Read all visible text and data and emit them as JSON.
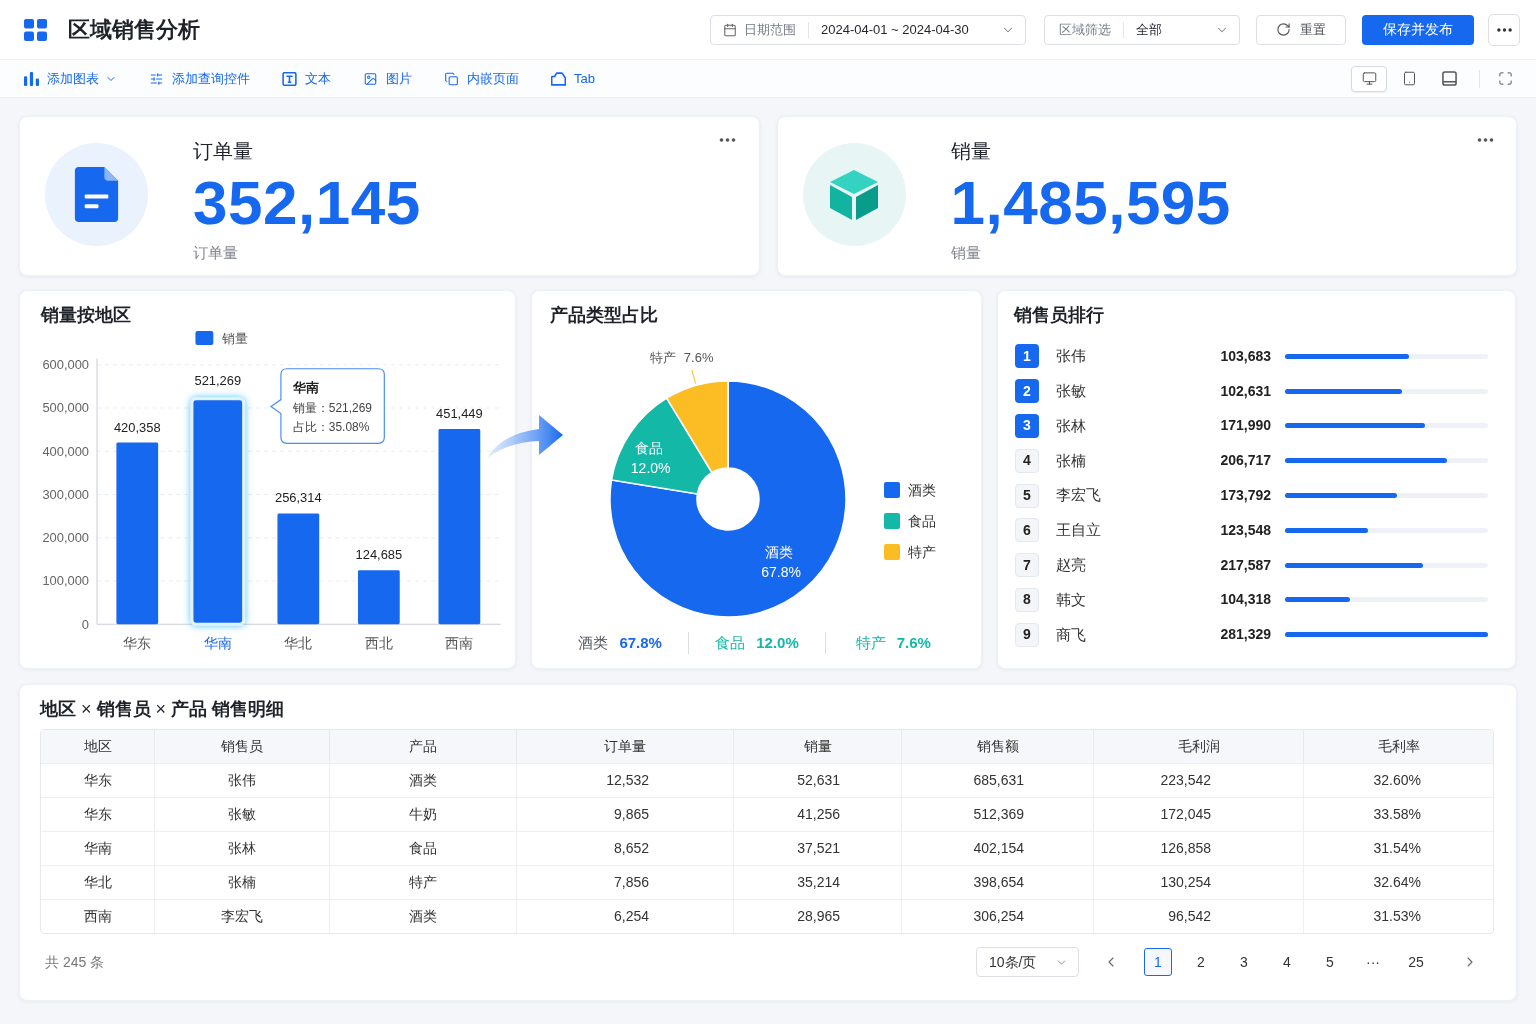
{
  "header": {
    "title": "区域销售分析",
    "filters": [
      {
        "kind": "date",
        "label": "日期范围",
        "value": "2024-04-01 ~ 2024-04-30"
      },
      {
        "kind": "select",
        "label": "区域筛选",
        "value": "全部"
      }
    ],
    "buttons": [
      {
        "kind": "reset",
        "label": "重置"
      },
      {
        "kind": "primary",
        "label": "保存并发布"
      }
    ]
  },
  "toolbar": {
    "items": [
      {
        "label": "添加图表",
        "dropdown": true
      },
      {
        "label": "添加查询控件",
        "dropdown": false
      },
      {
        "label": "文本",
        "dropdown": false
      },
      {
        "label": "图片",
        "dropdown": false
      },
      {
        "label": "内嵌页面",
        "dropdown": false
      },
      {
        "label": "Tab",
        "dropdown": false
      }
    ],
    "device_views": [
      {
        "selected": true
      },
      {
        "selected": false
      },
      {
        "selected": false
      }
    ]
  },
  "kpi_cards": [
    {
      "kind": "orders",
      "title": "订单量",
      "value": "352,145",
      "caption": "订单量"
    },
    {
      "kind": "volume",
      "title": "销量",
      "value": "1,485,595",
      "caption": "销量"
    }
  ],
  "bar_chart": {
    "title": "销量按地区",
    "chart_data": {
      "type": "bar",
      "categories": [
        "华东",
        "华南",
        "华北",
        "西北",
        "西南"
      ],
      "series": [
        {
          "name": "销量",
          "color": "#1668ef",
          "values": [
            420358,
            521269,
            256314,
            124685,
            451449
          ]
        }
      ],
      "ylim": [
        0,
        600000
      ],
      "yticks": [
        {
          "value": 0,
          "label": "0"
        },
        {
          "value": 100000,
          "label": "100,000"
        },
        {
          "value": 200000,
          "label": "200,000"
        },
        {
          "value": 300000,
          "label": "300,000"
        },
        {
          "value": 400000,
          "label": "400,000"
        },
        {
          "value": 500000,
          "label": "500,000"
        },
        {
          "value": 600000,
          "label": "600,000"
        }
      ],
      "value_labels": [
        "420,358",
        "521,269",
        "256,314",
        "124,685",
        "451,449"
      ],
      "grid": true,
      "legend": "top"
    },
    "bars": [
      {
        "selected": false
      },
      {
        "selected": true
      },
      {
        "selected": false
      },
      {
        "selected": false
      },
      {
        "selected": false
      }
    ],
    "tooltip": {
      "title": "华南",
      "rows": [
        "销量：521,269",
        "占比：35.08%"
      ]
    }
  },
  "pie_chart": {
    "title": "产品类型占比",
    "chart_data": {
      "type": "donut",
      "categories": [
        "酒类",
        "食品",
        "特产"
      ],
      "values": [
        67.8,
        12.0,
        7.6
      ],
      "colors": [
        "#1668ef",
        "#13b8a6",
        "#fbbd23"
      ],
      "value_labels": [
        "67.8%",
        "12.0%",
        "7.6%"
      ],
      "legend": "right"
    },
    "summary": [
      {
        "label": "酒类",
        "value": "67.8%",
        "color": "#1668ef"
      },
      {
        "label": "食品",
        "value": "12.0%",
        "color": "#13b8a6"
      },
      {
        "label": "特产",
        "value": "7.6%",
        "color": "#13b8a6"
      }
    ]
  },
  "ranking": {
    "title": "销售员排行",
    "rows": [
      {
        "rank": "1",
        "name": "张伟",
        "value": "103,683",
        "level": 0.61,
        "highlighted": true
      },
      {
        "rank": "2",
        "name": "张敏",
        "value": "102,631",
        "level": 0.575,
        "highlighted": true
      },
      {
        "rank": "3",
        "name": "张林",
        "value": "171,990",
        "level": 0.69,
        "highlighted": true
      },
      {
        "rank": "4",
        "name": "张楠",
        "value": "206,717",
        "level": 0.8,
        "highlighted": false
      },
      {
        "rank": "5",
        "name": "李宏飞",
        "value": "173,792",
        "level": 0.55,
        "highlighted": false
      },
      {
        "rank": "6",
        "name": "王自立",
        "value": "123,548",
        "level": 0.41,
        "highlighted": false
      },
      {
        "rank": "7",
        "name": "赵亮",
        "value": "217,587",
        "level": 0.68,
        "highlighted": false
      },
      {
        "rank": "8",
        "name": "韩文",
        "value": "104,318",
        "level": 0.32,
        "highlighted": false
      },
      {
        "rank": "9",
        "name": "商飞",
        "value": "281,329",
        "level": 1.0,
        "highlighted": false
      }
    ]
  },
  "detail_section": {
    "title": "**地区** × **销售员** × **产品 销售明细**",
    "table": {
      "columns": [
        "地区",
        "销售员",
        "产品",
        "订单量",
        "销量",
        "销售额",
        "毛利润",
        "毛利率"
      ],
      "rows": [
        [
          "华东",
          "张伟",
          "酒类",
          "12,532",
          "52,631",
          "685,631",
          "223,542",
          "32.60%"
        ],
        [
          "华东",
          "张敏",
          "牛奶",
          "9,865",
          "41,256",
          "512,369",
          "172,045",
          "33.58%"
        ],
        [
          "华南",
          "张林",
          "食品",
          "8,652",
          "37,521",
          "402,154",
          "126,858",
          "31.54%"
        ],
        [
          "华北",
          "张楠",
          "特产",
          "7,856",
          "35,214",
          "398,654",
          "130,254",
          "32.64%"
        ],
        [
          "西南",
          "李宏飞",
          "酒类",
          "6,254",
          "28,965",
          "306,254",
          "96,542",
          "31.53%"
        ]
      ]
    },
    "pagination": {
      "total": "共 245 条",
      "page_size": "10条/页",
      "pages": [
        {
          "label": "1",
          "selected": true
        },
        {
          "label": "2",
          "selected": false
        },
        {
          "label": "3",
          "selected": false
        },
        {
          "label": "4",
          "selected": false
        },
        {
          "label": "5",
          "selected": false
        },
        {
          "label": "···",
          "selected": false
        },
        {
          "label": "25",
          "selected": false
        }
      ]
    }
  }
}
